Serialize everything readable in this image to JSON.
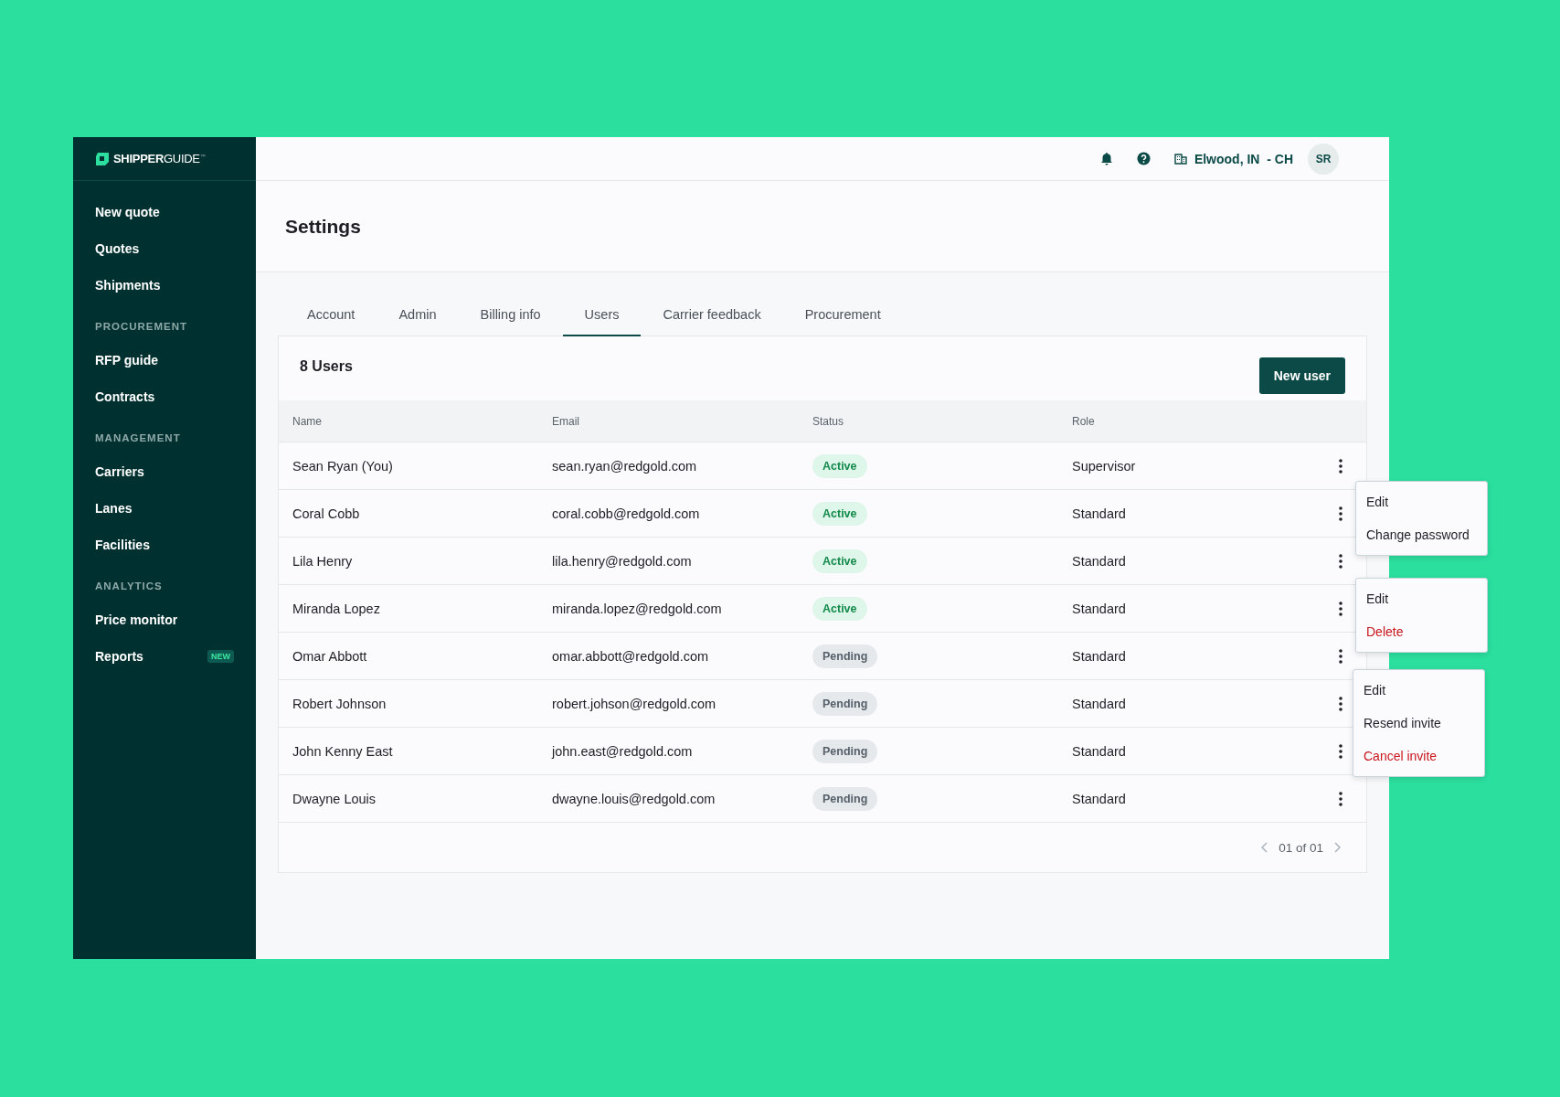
{
  "logo": {
    "text": "**SHIPPER**GUIDE$^{™}$"
  },
  "sidebar": {
    "sections": [
      {
        "items": [
          {
            "label": "New quote"
          },
          {
            "label": "Quotes"
          },
          {
            "label": "Shipments"
          }
        ]
      },
      {
        "heading": "PROCUREMENT",
        "items": [
          {
            "label": "RFP guide"
          },
          {
            "label": "Contracts"
          }
        ]
      },
      {
        "heading": "MANAGEMENT",
        "items": [
          {
            "label": "Carriers"
          },
          {
            "label": "Lanes"
          },
          {
            "label": "Facilities"
          }
        ]
      },
      {
        "heading": "ANALYTICS",
        "items": [
          {
            "label": "Price monitor"
          },
          {
            "label": "Reports",
            "badge": "NEW"
          }
        ]
      }
    ]
  },
  "header": {
    "location": "Elwood, IN  - CH",
    "avatar": "SR"
  },
  "page_title": "Settings",
  "tabs": [
    {
      "label": "Account",
      "selected": false
    },
    {
      "label": "Admin",
      "selected": false
    },
    {
      "label": "Billing info",
      "selected": false
    },
    {
      "label": "Users",
      "selected": true
    },
    {
      "label": "Carrier feedback",
      "selected": false
    },
    {
      "label": "Procurement",
      "selected": false
    }
  ],
  "users": {
    "count": "8 Users",
    "new_button": "New user",
    "columns": [
      "Name",
      "Email",
      "Status",
      "Role"
    ],
    "rows": [
      {
        "name": "Sean Ryan (You)",
        "email": "sean.ryan@redgold.com",
        "status": "Active",
        "kind": "active",
        "role": "Supervisor"
      },
      {
        "name": "Coral Cobb",
        "email": "coral.cobb@redgold.com",
        "status": "Active",
        "kind": "active",
        "role": "Standard"
      },
      {
        "name": "Lila Henry",
        "email": "lila.henry@redgold.com",
        "status": "Active",
        "kind": "active",
        "role": "Standard"
      },
      {
        "name": "Miranda Lopez",
        "email": "miranda.lopez@redgold.com",
        "status": "Active",
        "kind": "active",
        "role": "Standard"
      },
      {
        "name": "Omar Abbott",
        "email": "omar.abbott@redgold.com",
        "status": "Pending",
        "kind": "pending",
        "role": "Standard"
      },
      {
        "name": "Robert Johnson",
        "email": "robert.johson@redgold.com",
        "status": "Pending",
        "kind": "pending",
        "role": "Standard"
      },
      {
        "name": "John Kenny East",
        "email": "john.east@redgold.com",
        "status": "Pending",
        "kind": "pending",
        "role": "Standard"
      },
      {
        "name": "Dwayne Louis",
        "email": "dwayne.louis@redgold.com",
        "status": "Pending",
        "kind": "pending",
        "role": "Standard"
      }
    ],
    "pagination": "01 of 01"
  },
  "menus": [
    {
      "items": [
        {
          "label": "Edit",
          "destructive": false
        },
        {
          "label": "Change password",
          "destructive": false
        }
      ]
    },
    {
      "items": [
        {
          "label": "Edit",
          "destructive": false
        },
        {
          "label": "Delete",
          "destructive": true
        }
      ]
    },
    {
      "items": [
        {
          "label": "Edit",
          "destructive": false
        },
        {
          "label": "Resend invite",
          "destructive": false
        },
        {
          "label": "Cancel invite",
          "destructive": true
        }
      ]
    }
  ]
}
